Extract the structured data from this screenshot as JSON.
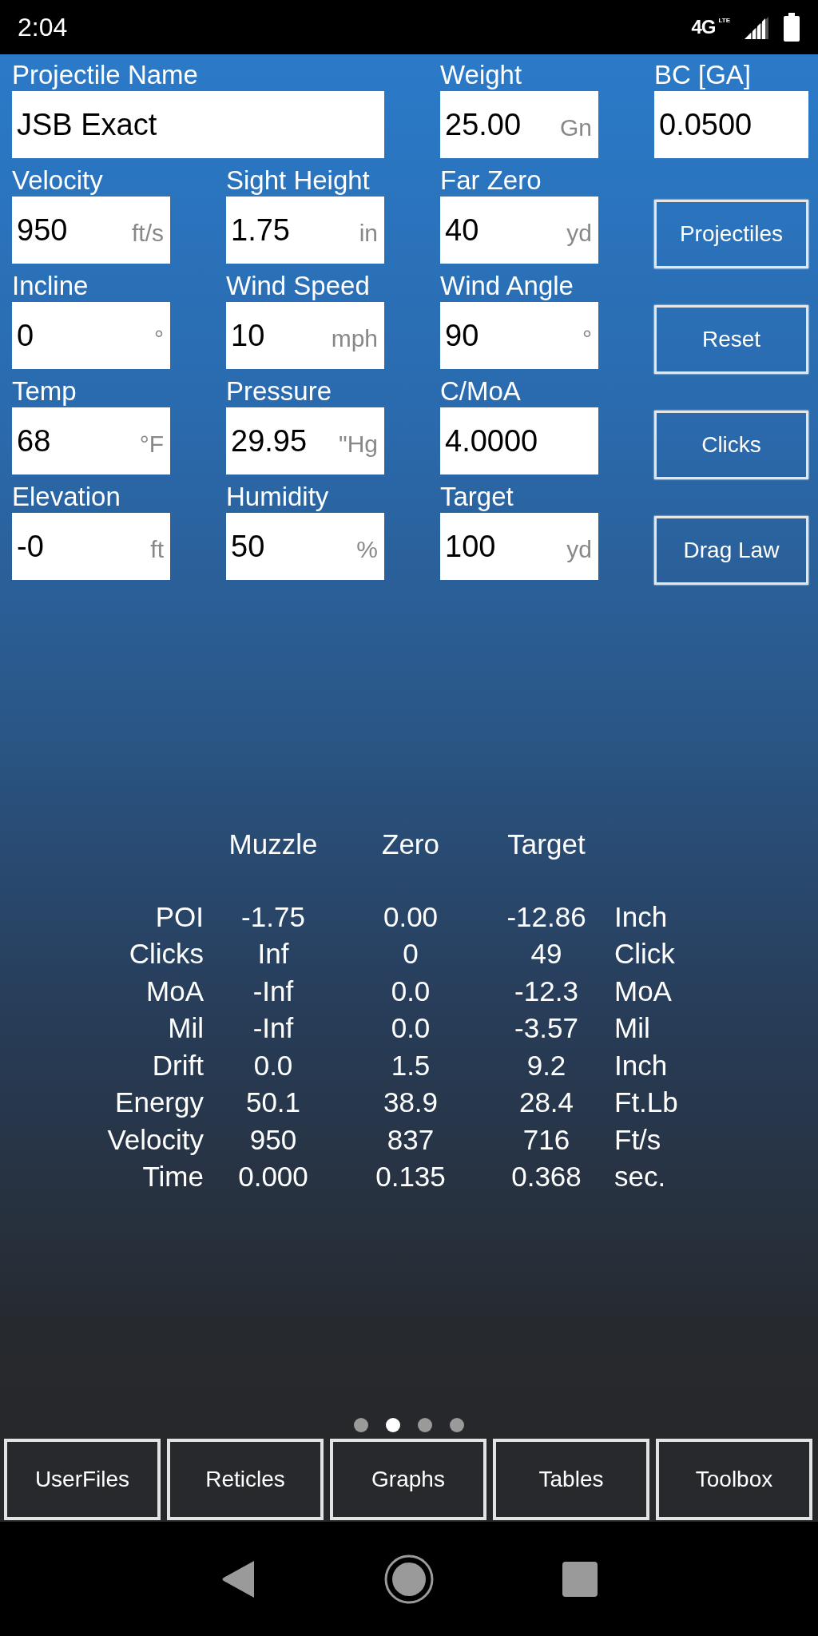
{
  "status_bar": {
    "time": "2:04",
    "network": "4G",
    "network_sub": "LTE"
  },
  "header_fields": [
    {
      "label": "Projectile Name",
      "value": "JSB Exact"
    },
    {
      "label": "Weight",
      "value": "25.00",
      "unit": "Gn"
    },
    {
      "label": "BC [GA]",
      "value": "0.0500"
    }
  ],
  "input_rows": [
    {
      "fields": [
        {
          "label": "Velocity",
          "value": "950",
          "unit": "ft/s"
        },
        {
          "label": "Sight Height",
          "value": "1.75",
          "unit": "in"
        },
        {
          "label": "Far Zero",
          "value": "40",
          "unit": "yd"
        }
      ],
      "button": "Projectiles"
    },
    {
      "fields": [
        {
          "label": "Incline",
          "value": "0",
          "unit": "°"
        },
        {
          "label": "Wind Speed",
          "value": "10",
          "unit": "mph"
        },
        {
          "label": "Wind Angle",
          "value": "90",
          "unit": "°"
        }
      ],
      "button": "Reset"
    },
    {
      "fields": [
        {
          "label": "Temp",
          "value": "68",
          "unit": "°F"
        },
        {
          "label": "Pressure",
          "value": "29.95",
          "unit": "\"Hg"
        },
        {
          "label": "C/MoA",
          "value": "4.0000"
        }
      ],
      "button": "Clicks"
    },
    {
      "fields": [
        {
          "label": "Elevation",
          "value": "-0",
          "unit": "ft"
        },
        {
          "label": "Humidity",
          "value": "50",
          "unit": "%"
        },
        {
          "label": "Target",
          "value": "100",
          "unit": "yd"
        }
      ],
      "button": "Drag Law"
    }
  ],
  "results": {
    "columns": [
      "Muzzle",
      "Zero",
      "Target"
    ],
    "rows": [
      {
        "label": "POI",
        "values": [
          "-1.75",
          "0.00",
          "-12.86"
        ],
        "unit": "Inch"
      },
      {
        "label": "Clicks",
        "values": [
          "Inf",
          "0",
          "49"
        ],
        "unit": "Click"
      },
      {
        "label": "MoA",
        "values": [
          "-Inf",
          "0.0",
          "-12.3"
        ],
        "unit": "MoA"
      },
      {
        "label": "Mil",
        "values": [
          "-Inf",
          "0.0",
          "-3.57"
        ],
        "unit": "Mil"
      },
      {
        "label": "Drift",
        "values": [
          "0.0",
          "1.5",
          "9.2"
        ],
        "unit": "Inch"
      },
      {
        "label": "Energy",
        "values": [
          "50.1",
          "38.9",
          "28.4"
        ],
        "unit": "Ft.Lb"
      },
      {
        "label": "Velocity",
        "values": [
          "950",
          "837",
          "716"
        ],
        "unit": "Ft/s"
      },
      {
        "label": "Time",
        "values": [
          "0.000",
          "0.135",
          "0.368"
        ],
        "unit": "sec."
      }
    ]
  },
  "page_dots": [
    {
      "selected": false
    },
    {
      "selected": true
    },
    {
      "selected": false
    },
    {
      "selected": false
    }
  ],
  "bottom_buttons": [
    "UserFiles",
    "Reticles",
    "Graphs",
    "Tables",
    "Toolbox"
  ]
}
